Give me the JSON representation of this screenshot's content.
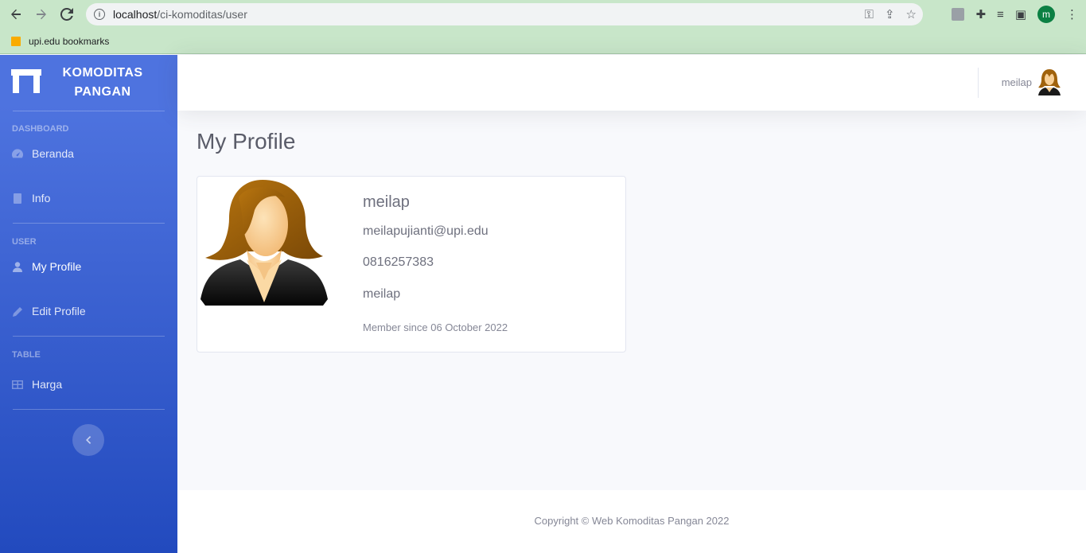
{
  "browser": {
    "url_host": "localhost",
    "url_path": "/ci-komoditas/user",
    "profile_initial": "m",
    "bookmark_label": "upi.edu bookmarks"
  },
  "sidebar": {
    "brand_line1": "KOMODITAS",
    "brand_line2": "PANGAN",
    "sections": [
      {
        "heading": "DASHBOARD",
        "items": [
          {
            "label": "Beranda",
            "icon": "tachometer-icon"
          },
          {
            "label": "Info",
            "icon": "file-icon"
          }
        ]
      },
      {
        "heading": "USER",
        "items": [
          {
            "label": "My Profile",
            "icon": "user-icon"
          },
          {
            "label": "Edit Profile",
            "icon": "pencil-icon"
          }
        ]
      },
      {
        "heading": "TABLE",
        "items": [
          {
            "label": "Harga",
            "icon": "table-icon"
          }
        ]
      }
    ],
    "toggle_icon": "chevron-left-icon"
  },
  "topbar": {
    "username": "meilap"
  },
  "main": {
    "title": "My Profile",
    "profile": {
      "name": "meilap",
      "email": "meilapujianti@upi.edu",
      "phone": "0816257383",
      "username": "meilap",
      "member_since": "Member since 06 October 2022"
    }
  },
  "footer": {
    "copyright": "Copyright © Web Komoditas Pangan 2022"
  },
  "colors": {
    "sidebar_start": "#4e73df",
    "sidebar_end": "#224abe",
    "text_muted": "#858796",
    "browser_bar": "#c8e6c9"
  }
}
